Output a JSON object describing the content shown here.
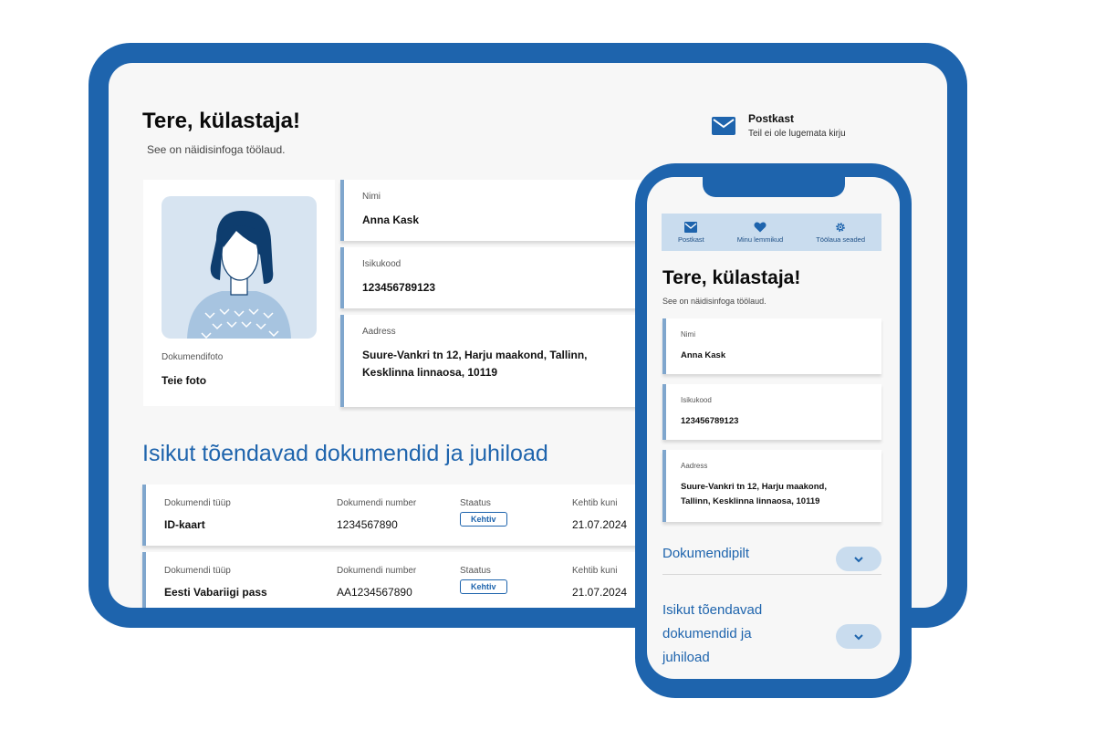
{
  "colors": {
    "brand": "#1e64ad",
    "accent_light": "#c9dcee",
    "field_border": "#7fa6cd",
    "background": "#f7f7f7"
  },
  "tablet": {
    "greeting": "Tere, külastaja!",
    "subtitle": "See on näidisinfoga töölaud.",
    "mailbox": {
      "icon": "mail-icon",
      "title": "Postkast",
      "text": "Teil ei ole lugemata kirju"
    },
    "photo": {
      "label": "Dokumendifoto",
      "value": "Teie foto"
    },
    "fields": [
      {
        "label": "Nimi",
        "value": "Anna Kask"
      },
      {
        "label": "Isikukood",
        "value": "123456789123"
      },
      {
        "label": "Aadress",
        "value_line1": "Suure-Vankri tn 12, Harju maakond, Tallinn,",
        "value_line2": "Kesklinna linnaosa, 10119"
      }
    ],
    "documents_heading": "Isikut tõendavad dokumendid ja juhiload",
    "documents": [
      {
        "type_label": "Dokumendi tüüp",
        "type": "ID-kaart",
        "number_label": "Dokumendi number",
        "number": "1234567890",
        "status_label": "Staatus",
        "status": "Kehtiv",
        "valid_label": "Kehtib kuni",
        "valid": "21.07.2024"
      },
      {
        "type_label": "Dokumendi tüüp",
        "type": "Eesti Vabariigi pass",
        "number_label": "Dokumendi number",
        "number": "AA1234567890",
        "status_label": "Staatus",
        "status": "Kehtiv",
        "valid_label": "Kehtib kuni",
        "valid": "21.07.2024"
      }
    ]
  },
  "phone": {
    "nav": [
      {
        "icon": "mail-icon",
        "label": "Postkast"
      },
      {
        "icon": "heart-icon",
        "label": "Minu lemmikud"
      },
      {
        "icon": "gear-icon",
        "label": "Töölaua seaded"
      }
    ],
    "greeting": "Tere, külastaja!",
    "subtitle": "See on näidisinfoga töölaud.",
    "fields": [
      {
        "label": "Nimi",
        "value": "Anna Kask"
      },
      {
        "label": "Isikukood",
        "value": "123456789123"
      },
      {
        "label": "Aadress",
        "value_line1": "Suure-Vankri tn 12, Harju maakond,",
        "value_line2": "Tallinn, Kesklinna linnaosa, 10119"
      }
    ],
    "accordions": [
      {
        "label": "Dokumendipilt",
        "icon": "chevron-down-icon"
      },
      {
        "label_line1": "Isikut tõendavad",
        "label_line2": "dokumendid ja",
        "label_line3": "juhiload",
        "icon": "chevron-down-icon"
      }
    ]
  }
}
